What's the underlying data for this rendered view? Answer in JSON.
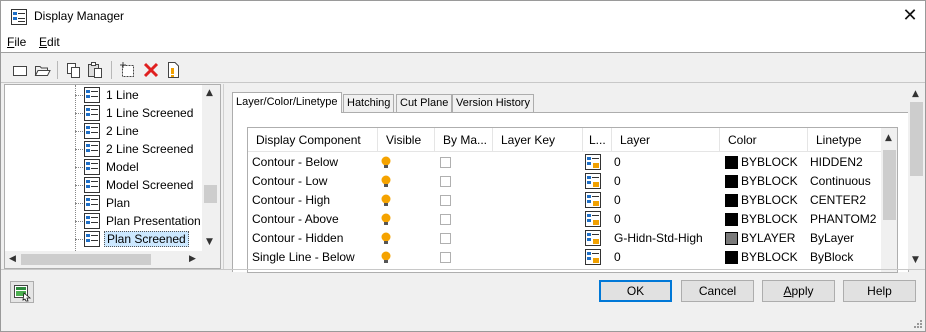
{
  "window": {
    "title": "Display Manager",
    "close_glyph": "✕"
  },
  "menu": {
    "file": {
      "mnemonic": "F",
      "rest": "ile"
    },
    "edit": {
      "mnemonic": "E",
      "rest": "dit"
    }
  },
  "toolbar": {
    "icons": [
      "new-icon",
      "open-icon",
      "copy-icon",
      "paste-icon",
      "add-item-icon",
      "delete-icon",
      "properties-icon"
    ]
  },
  "tree": {
    "items": [
      {
        "label": "1 Line",
        "selected": false
      },
      {
        "label": "1 Line Screened",
        "selected": false
      },
      {
        "label": "2 Line",
        "selected": false
      },
      {
        "label": "2 Line Screened",
        "selected": false
      },
      {
        "label": "Model",
        "selected": false
      },
      {
        "label": "Model Screened",
        "selected": false
      },
      {
        "label": "Plan",
        "selected": false
      },
      {
        "label": "Plan Presentation",
        "selected": false
      },
      {
        "label": "Plan Screened",
        "selected": true
      }
    ]
  },
  "tabs": [
    {
      "label": "Layer/Color/Linetype",
      "active": true
    },
    {
      "label": "Hatching",
      "active": false
    },
    {
      "label": "Cut Plane",
      "active": false
    },
    {
      "label": "Version History",
      "active": false
    }
  ],
  "grid": {
    "columns": [
      "Display Component",
      "Visible",
      "By Ma...",
      "Layer Key",
      "L...",
      "Layer",
      "Color",
      "Linetype"
    ],
    "rows": [
      {
        "component": "Contour - Below",
        "layer": "0",
        "color": "BYBLOCK",
        "swatch": "#000000",
        "linetype": "HIDDEN2"
      },
      {
        "component": "Contour - Low",
        "layer": "0",
        "color": "BYBLOCK",
        "swatch": "#000000",
        "linetype": "Continuous"
      },
      {
        "component": "Contour - High",
        "layer": "0",
        "color": "BYBLOCK",
        "swatch": "#000000",
        "linetype": "CENTER2"
      },
      {
        "component": "Contour - Above",
        "layer": "0",
        "color": "BYBLOCK",
        "swatch": "#000000",
        "linetype": "PHANTOM2"
      },
      {
        "component": "Contour - Hidden",
        "layer": "G-Hidn-Std-High",
        "color": "BYLAYER",
        "swatch": "#7a7a7a",
        "linetype": "ByLayer"
      },
      {
        "component": "Single Line - Below",
        "layer": "0",
        "color": "BYBLOCK",
        "swatch": "#000000",
        "linetype": "ByBlock"
      }
    ]
  },
  "buttons": {
    "ok": "OK",
    "cancel": "Cancel",
    "apply": {
      "mnemonic": "A",
      "rest": "pply"
    },
    "help": "Help"
  },
  "colors": {
    "accent": "#0078d7",
    "bulb": "#f5a300",
    "selection": "#cce8ff"
  }
}
